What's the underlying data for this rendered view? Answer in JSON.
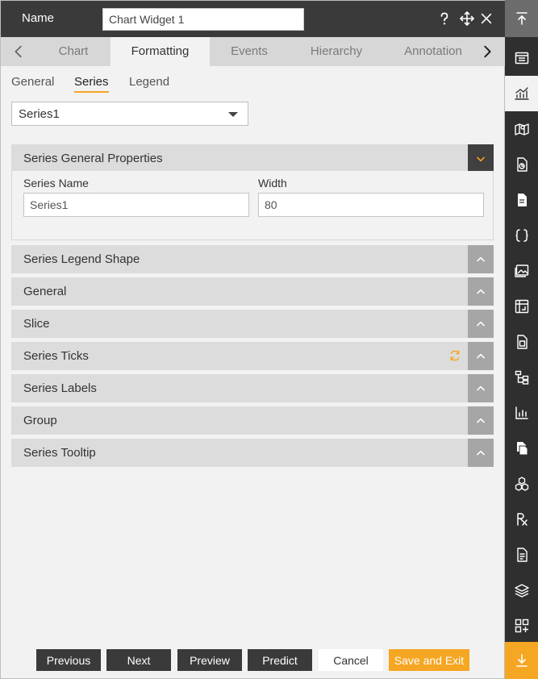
{
  "header": {
    "name_label": "Name",
    "name_value": "Chart Widget 1"
  },
  "tabs": [
    {
      "label": "Chart"
    },
    {
      "label": "Formatting",
      "active": true
    },
    {
      "label": "Events"
    },
    {
      "label": "Hierarchy"
    },
    {
      "label": "Annotation"
    }
  ],
  "subtabs": [
    {
      "label": "General"
    },
    {
      "label": "Series",
      "active": true
    },
    {
      "label": "Legend"
    }
  ],
  "series_select": {
    "value": "Series1"
  },
  "general_properties": {
    "title": "Series General Properties",
    "series_name_label": "Series Name",
    "series_name_value": "Series1",
    "width_label": "Width",
    "width_value": "80"
  },
  "sections": [
    {
      "title": "Series Legend Shape"
    },
    {
      "title": "General"
    },
    {
      "title": "Slice"
    },
    {
      "title": "Series Ticks",
      "has_refresh": true
    },
    {
      "title": "Series Labels"
    },
    {
      "title": "Group"
    },
    {
      "title": "Series Tooltip"
    }
  ],
  "footer": {
    "previous": "Previous",
    "next": "Next",
    "preview": "Preview",
    "predict": "Predict",
    "cancel": "Cancel",
    "save_exit": "Save and Exit"
  },
  "sidebar_icons": [
    "collapse-top-icon",
    "table-list-icon",
    "chart-icon",
    "map-icon",
    "document-chart-icon",
    "document-icon",
    "braces-icon",
    "image-icon",
    "pivot-table-icon",
    "calculator-document-icon",
    "hierarchy-icon",
    "bar-chart-icon",
    "copy-document-icon",
    "cubes-icon",
    "rx-icon",
    "report-icon",
    "layers-icon",
    "add-widget-icon",
    "download-icon"
  ],
  "colors": {
    "accent": "#f5a623",
    "header_bg": "#3a3a3a",
    "panel_bg": "#f2f2f2"
  }
}
